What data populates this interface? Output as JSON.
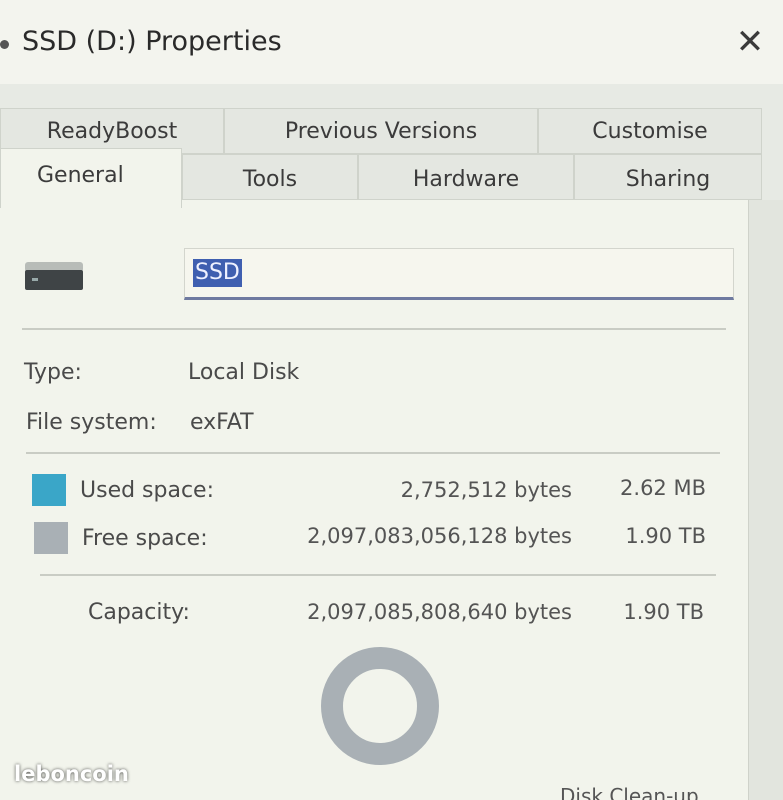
{
  "window": {
    "title": "SSD (D:) Properties",
    "close_glyph": "✕"
  },
  "tabs": {
    "row1": [
      "ReadyBoost",
      "Previous Versions",
      "Customise"
    ],
    "row2": [
      "General",
      "Tools",
      "Hardware",
      "Sharing"
    ],
    "active": "General"
  },
  "general": {
    "drive_name": "SSD",
    "type_label": "Type:",
    "type_value": "Local Disk",
    "fs_label": "File system:",
    "fs_value": "exFAT",
    "used": {
      "label": "Used space:",
      "bytes": "2,752,512 bytes",
      "size": "2.62 MB",
      "color": "#3aa6c8"
    },
    "free": {
      "label": "Free space:",
      "bytes": "2,097,083,056,128 bytes",
      "size": "1.90 TB",
      "color": "#a9b0b5"
    },
    "capacity": {
      "label": "Capacity:",
      "bytes": "2,097,085,808,640 bytes",
      "size": "1.90 TB"
    },
    "disk_cleanup_label": "Disk Clean-up"
  },
  "usage_fraction": 1.3e-06,
  "watermark": "leboncoin"
}
